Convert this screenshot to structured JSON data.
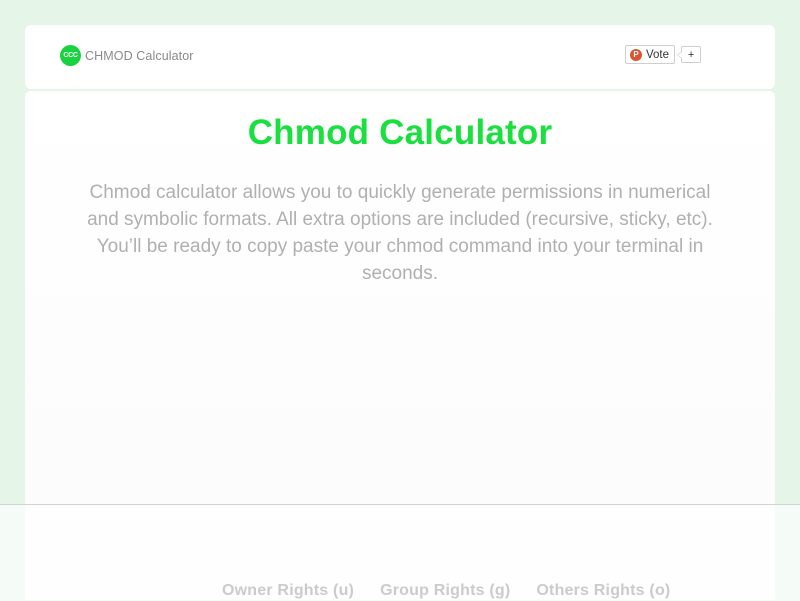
{
  "header": {
    "logo_badge": "CCC",
    "logo_text": "CHMOD Calculator"
  },
  "producthunt": {
    "logo_letter": "P",
    "vote_label": "Vote",
    "count_label": "+"
  },
  "main": {
    "title": "Chmod Calculator",
    "intro": "Chmod calculator allows you to quickly generate permissions in numerical and symbolic formats. All extra options are included (recursive, sticky, etc). You’ll be ready to copy paste your chmod command into your terminal in seconds."
  },
  "rights": {
    "owner": "Owner Rights (u)",
    "group": "Group Rights (g)",
    "others": "Others Rights (o)"
  },
  "colors": {
    "accent_green": "#19e03f",
    "page_background": "#e5f5e7",
    "producthunt_orange": "#da552f"
  }
}
